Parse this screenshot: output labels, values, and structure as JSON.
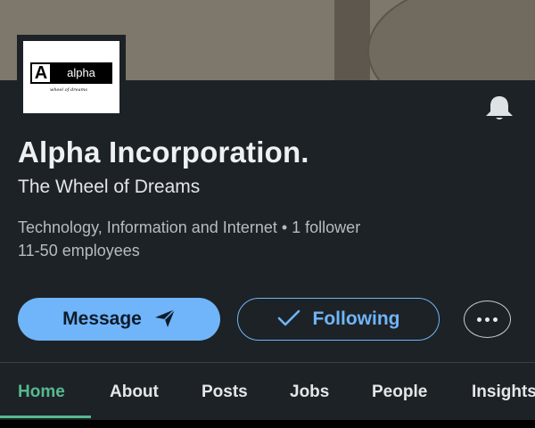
{
  "company": {
    "logo_letter": "A",
    "logo_word": "alpha",
    "logo_tagline": "wheel of dreams",
    "name": "Alpha Incorporation.",
    "tagline": "The Wheel of Dreams",
    "meta_line1": "Technology, Information and Internet • 1 follower",
    "meta_line2": "11-50 employees"
  },
  "actions": {
    "message_label": "Message",
    "following_label": "Following"
  },
  "tabs": [
    {
      "label": "Home",
      "active": true
    },
    {
      "label": "About"
    },
    {
      "label": "Posts"
    },
    {
      "label": "Jobs"
    },
    {
      "label": "People"
    },
    {
      "label": "Insights"
    }
  ],
  "colors": {
    "accent": "#70b5f9",
    "active_tab": "#57b98e",
    "background": "#1d2226"
  },
  "icons": {
    "notification": "bell-icon",
    "message": "send-icon",
    "following": "checkmark-icon",
    "more": "more-options-icon"
  }
}
